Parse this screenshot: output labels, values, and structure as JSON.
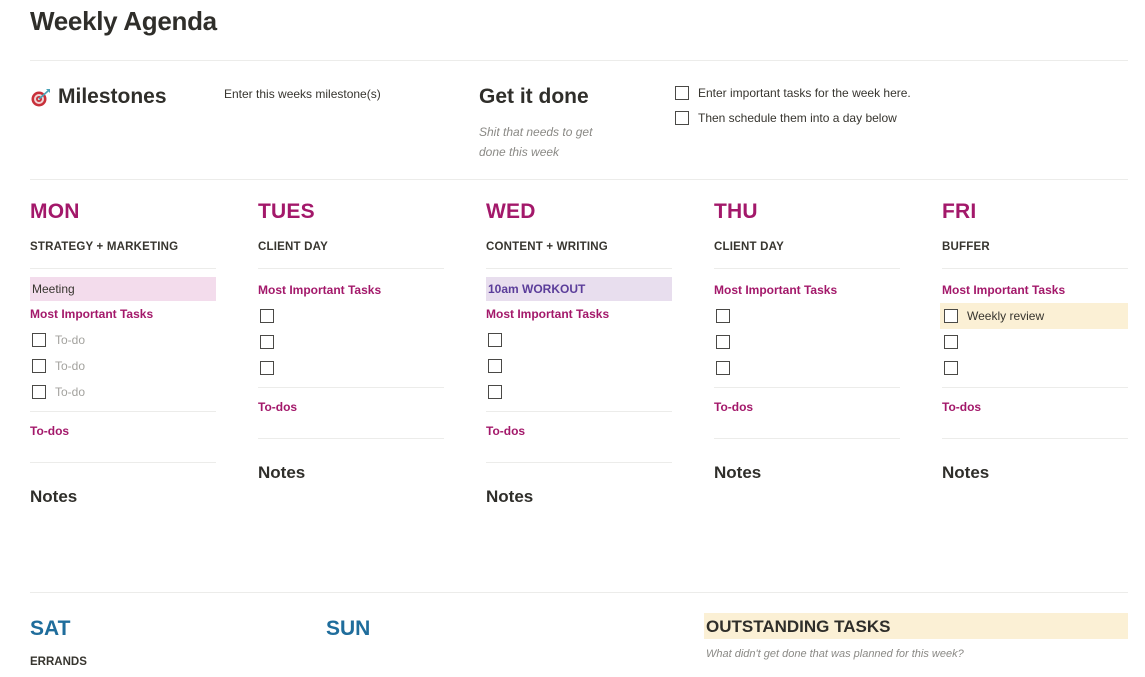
{
  "page": {
    "title": "Weekly Agenda"
  },
  "milestones": {
    "icon": "target-dart-icon",
    "title": "Milestones",
    "text": "Enter this weeks milestone(s)"
  },
  "get_it_done": {
    "title": "Get it done",
    "subtitle": "Shit that needs to get done this week",
    "tasks": [
      {
        "label": "Enter important tasks for the week here.",
        "checked": false
      },
      {
        "label": "Then schedule them into a day below",
        "checked": false
      }
    ]
  },
  "labels": {
    "most_important_tasks": "Most Important Tasks",
    "todos": "To-dos",
    "notes": "Notes",
    "todo_placeholder": "To-do"
  },
  "days": [
    {
      "name": "MON",
      "theme": "STRATEGY + MARKETING",
      "highlight": "Meeting",
      "highlight_color": "#f3dcec",
      "tasks": [
        {
          "label": "To-do",
          "placeholder": true
        },
        {
          "label": "To-do",
          "placeholder": true
        },
        {
          "label": "To-do",
          "placeholder": true
        }
      ]
    },
    {
      "name": "TUES",
      "theme": "CLIENT DAY",
      "tasks": [
        {
          "label": ""
        },
        {
          "label": ""
        },
        {
          "label": ""
        }
      ]
    },
    {
      "name": "WED",
      "theme": "CONTENT + WRITING",
      "highlight": "10am WORKOUT",
      "highlight_color": "#e8deee",
      "tasks": [
        {
          "label": ""
        },
        {
          "label": ""
        },
        {
          "label": ""
        }
      ]
    },
    {
      "name": "THU",
      "theme": "CLIENT DAY",
      "tasks": [
        {
          "label": ""
        },
        {
          "label": ""
        },
        {
          "label": ""
        }
      ]
    },
    {
      "name": "FRI",
      "theme": "BUFFER",
      "tasks": [
        {
          "label": "Weekly review",
          "highlighted": true
        },
        {
          "label": ""
        },
        {
          "label": ""
        }
      ]
    }
  ],
  "weekend": [
    {
      "name": "SAT",
      "theme": "ERRANDS"
    },
    {
      "name": "SUN",
      "theme": ""
    }
  ],
  "outstanding": {
    "title": "OUTSTANDING TASKS",
    "subtitle": "What didn't get done that was planned for this week?"
  },
  "colors": {
    "weekday_accent": "#a3186a",
    "weekend_accent": "#1f6d9c",
    "highlight_yellow": "#fbf0d5"
  }
}
